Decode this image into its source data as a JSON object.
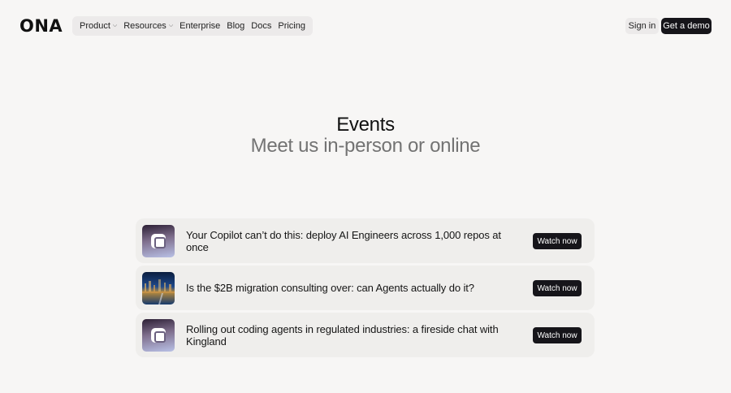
{
  "header": {
    "logo": "ONA",
    "nav": [
      {
        "label": "Product",
        "dropdown": true
      },
      {
        "label": "Resources",
        "dropdown": true
      },
      {
        "label": "Enterprise",
        "dropdown": false
      },
      {
        "label": "Blog",
        "dropdown": false
      },
      {
        "label": "Docs",
        "dropdown": false
      },
      {
        "label": "Pricing",
        "dropdown": false
      }
    ],
    "signin_label": "Sign in",
    "demo_label": "Get a demo"
  },
  "hero": {
    "title": "Events",
    "subtitle": "Meet us in-person or online"
  },
  "events": [
    {
      "title": "Your Copilot can’t do this: deploy AI Engineers across 1,000 repos at once",
      "button": "Watch now",
      "thumbnail": "ona-logo-icon"
    },
    {
      "title": "Is the $2B migration consulting over: can Agents actually do it?",
      "button": "Watch now",
      "thumbnail": "city-photo"
    },
    {
      "title": "Rolling out coding agents in regulated industries: a fireside chat with Kingland",
      "button": "Watch now",
      "thumbnail": "ona-logo-icon"
    }
  ],
  "colors": {
    "background": "#f7f6f5",
    "card": "#efeeec",
    "button_dark": "#16151a",
    "subtitle": "#737373"
  }
}
